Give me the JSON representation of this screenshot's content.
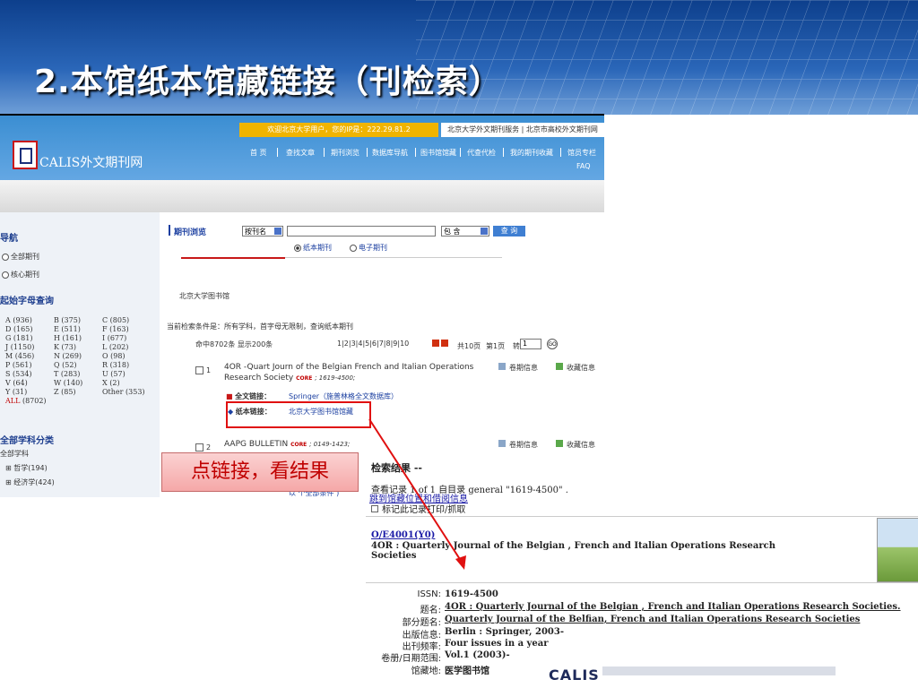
{
  "slide": {
    "title": "2.本馆纸本馆藏链接（刊检索）"
  },
  "site": {
    "logo_text": "CALIS外文期刊网",
    "welcome": "欢迎北京大学用户，您的IP是：222.29.81.2",
    "toplinks": "北京大学外文期刊服务 | 北京市高校外文期刊网",
    "nav": [
      "首 页",
      "查找文章",
      "期刊浏览",
      "数据库导航",
      "图书馆馆藏",
      "代查代检",
      "我的期刊收藏",
      "馆员专栏"
    ],
    "nav_faq": "FAQ"
  },
  "sidebar": {
    "nav_heading": "导航",
    "radios": [
      "全部期刊",
      "核心期刊"
    ],
    "letters_heading": "起始字母查询",
    "letters": [
      [
        "A (936)",
        "B (375)",
        "C (805)"
      ],
      [
        "D (165)",
        "E (511)",
        "F (163)"
      ],
      [
        "G (181)",
        "H (161)",
        "I (677)"
      ],
      [
        "J (1150)",
        "K (73)",
        "L (202)"
      ],
      [
        "M (456)",
        "N (269)",
        "O (98)"
      ],
      [
        "P (561)",
        "Q (52)",
        "R (318)"
      ],
      [
        "S (534)",
        "T (283)",
        "U (57)"
      ],
      [
        "V (64)",
        "W (140)",
        "X (2)"
      ],
      [
        "Y (31)",
        "Z (85)",
        "Other (353)"
      ]
    ],
    "all_link": "ALL",
    "all_count": "(8702)",
    "subject_heading": "全部学科分类",
    "tree_root": "全部学科",
    "tree_items": [
      "哲学(194)",
      "经济学(424)"
    ]
  },
  "search": {
    "section_label": "期刊浏览",
    "field_select": "按刊名",
    "match_select": "包 含",
    "button": "查 询",
    "radio_paper": "纸本期刊",
    "radio_electronic": "电子期刊",
    "library": "北京大学图书馆"
  },
  "results": {
    "conditions": "当前检索条件是：所有学科，首字母无限制，查询纸本期刊",
    "hits": "命中8702条 显示200条",
    "pager": "1|2|3|4|5|6|7|8|9|10",
    "total_pages": "共10页",
    "current_page": "第1页",
    "goto_label": "转",
    "goto_value": "1",
    "goto_button": "GO",
    "items": [
      {
        "num": "1",
        "title_line1": "4OR -Quart Journ of the Belgian French and Italian Operations",
        "title_line2": "Research Society",
        "core": "CORE",
        "issn": "; 1619-4500;",
        "vol_info": "卷期信息",
        "holding": "收藏信息",
        "fulltext_label": "全文链接：",
        "fulltext_link": "Springer（施普林格全文数据库）",
        "paper_label": "纸本链接：",
        "paper_link": "北京大学图书馆馆藏"
      },
      {
        "num": "2",
        "title_line1": "AAPG BULLETIN",
        "core": "CORE",
        "issn": "; 0149-1423;",
        "vol_info": "卷期信息",
        "holding": "收藏信息"
      }
    ],
    "partial_link": "以 个全部条件 )"
  },
  "callout": {
    "text": "点链接，看结果"
  },
  "opac": {
    "header": "检索结果 --",
    "view_record": "查看记录 1 of 1 自目录  general \"1619-4500\" .",
    "jump_link": "跳到馆藏位置和借阅信息",
    "mark": "标记此记录打印/抓取",
    "call_no": "O/E4001(Y0)",
    "title_line1": "4OR : Quarterly Journal of the Belgian , French and Italian Operations Research",
    "title_line2": "Societies",
    "fields": [
      {
        "label": "ISSN:",
        "value": "1619-4500",
        "link": false
      },
      {
        "label": "题名:",
        "value": "4OR : Quarterly Journal of the Belgian , French and Italian Operations Research Societies.",
        "link": true
      },
      {
        "label": "部分题名:",
        "value": "Quarterly Journal of the Belfian, French and Italian Operations Research Societies",
        "link": true
      },
      {
        "label": "出版信息:",
        "value": "Berlin : Springer, 2003-",
        "link": false
      },
      {
        "label": "出刊频率:",
        "value": "Four issues in a year",
        "link": false
      },
      {
        "label": "卷册/日期范围:",
        "value": "Vol.1 (2003)-",
        "link": false
      },
      {
        "label": "馆藏地:",
        "value": "医学图书馆",
        "link": false
      }
    ]
  },
  "footer": {
    "logo": "CALIS"
  },
  "colors": {
    "accent_red": "#e01010",
    "title_blue": "#1b3fa0",
    "banner_blue": "#0d3f8c"
  }
}
